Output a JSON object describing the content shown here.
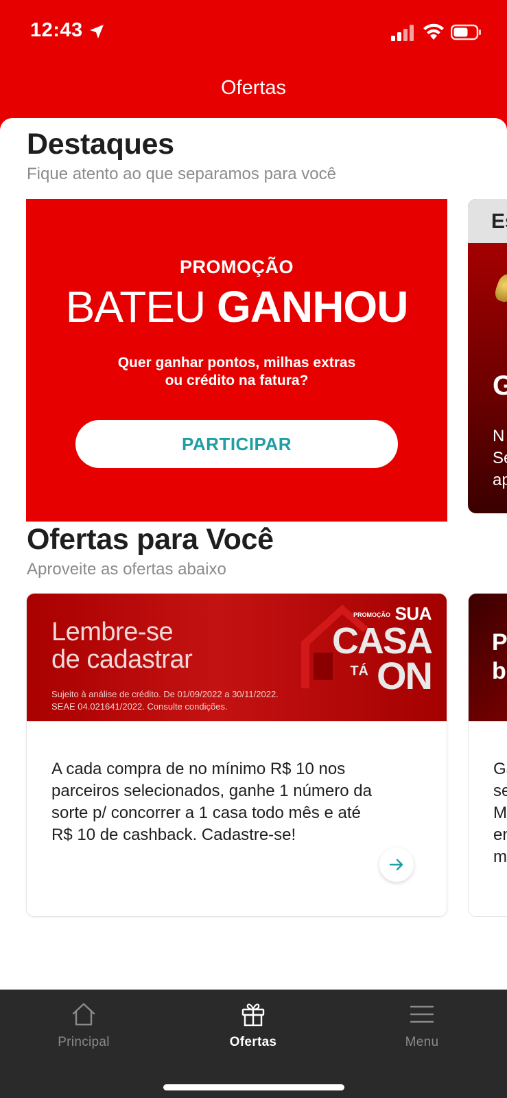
{
  "status": {
    "time": "12:43"
  },
  "header": {
    "title": "Ofertas"
  },
  "highlights": {
    "title": "Destaques",
    "subtitle": "Fique atento ao que separamos para você",
    "banner": {
      "kicker": "PROMOÇÃO",
      "title_part1": "BATEU ",
      "title_part2": "GANHOU",
      "desc_line1": "Quer ganhar pontos, milhas extras",
      "desc_line2": "ou crédito na fatura?",
      "button": "PARTICIPAR"
    },
    "peek": {
      "header": "Es",
      "letter": "G",
      "text_line1": "N",
      "text_line2": "Se",
      "text_line3": "ap"
    }
  },
  "offers": {
    "title": "Ofertas para Você",
    "subtitle": "Aproveite as ofertas abaixo",
    "card": {
      "banner_line1": "Lembre-se",
      "banner_line2": "de cadastrar",
      "legal_line1": "Sujeito à análise de crédito. De 01/09/2022 a 30/11/2022.",
      "legal_line2": "SEAE 04.021641/2022. Consulte condições.",
      "badge_small": "PROMOÇÃO",
      "badge_sua": "SUA",
      "badge_casa": "CASA",
      "badge_ta": "TÁ",
      "badge_on": "ON",
      "description": "A cada compra de no mínimo R$ 10 nos parceiros selecionados, ganhe 1 número da sorte p/ concorrer a 1 casa todo mês e até R$ 10 de cashback. Cadastre-se!"
    },
    "peek": {
      "banner_line1": "P",
      "banner_line2": "b",
      "text": [
        "Ga",
        "se",
        "M",
        "en",
        "m"
      ]
    }
  },
  "tabs": [
    {
      "label": "Principal",
      "icon": "home-icon"
    },
    {
      "label": "Ofertas",
      "icon": "gift-icon",
      "active": true
    },
    {
      "label": "Menu",
      "icon": "menu-icon"
    }
  ],
  "colors": {
    "brand": "#e60000",
    "accent": "#1f9ea3",
    "tabbar": "#2a2a2a"
  }
}
